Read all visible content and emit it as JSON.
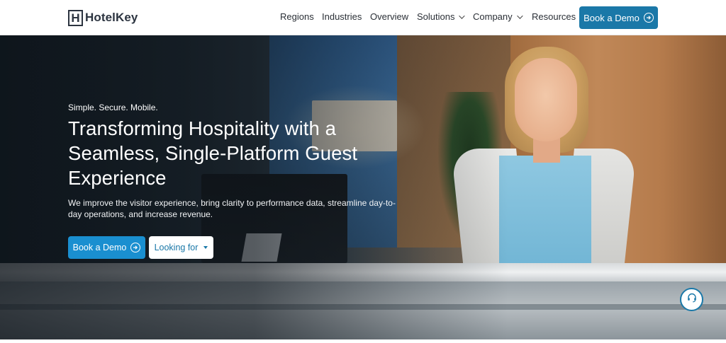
{
  "brand": {
    "logo_letter": "H",
    "name": "HotelKey"
  },
  "nav": {
    "items": [
      {
        "label": "Regions"
      },
      {
        "label": "Industries"
      },
      {
        "label": "Overview"
      },
      {
        "label": "Solutions"
      },
      {
        "label": "Company"
      },
      {
        "label": "Resources"
      }
    ],
    "cta_label": "Book a Demo"
  },
  "hero": {
    "tagline": "Simple. Secure. Mobile.",
    "headline": "Transforming Hospitality with a Seamless, Single-Platform Guest Experience",
    "subtext": "We improve the visitor experience, bring clarity to performance data, streamline day-to-day operations, and increase revenue.",
    "primary_button": "Book a Demo",
    "dropdown_label": "Looking for"
  },
  "colors": {
    "brand_blue": "#1a78a8",
    "hero_button_blue": "#1a8fd0",
    "logo_dark": "#2c3440"
  },
  "icons": {
    "cta_arrow": "arrow-circle-right-icon",
    "support": "headset-support-icon",
    "dropdown": "caret-down-icon"
  }
}
